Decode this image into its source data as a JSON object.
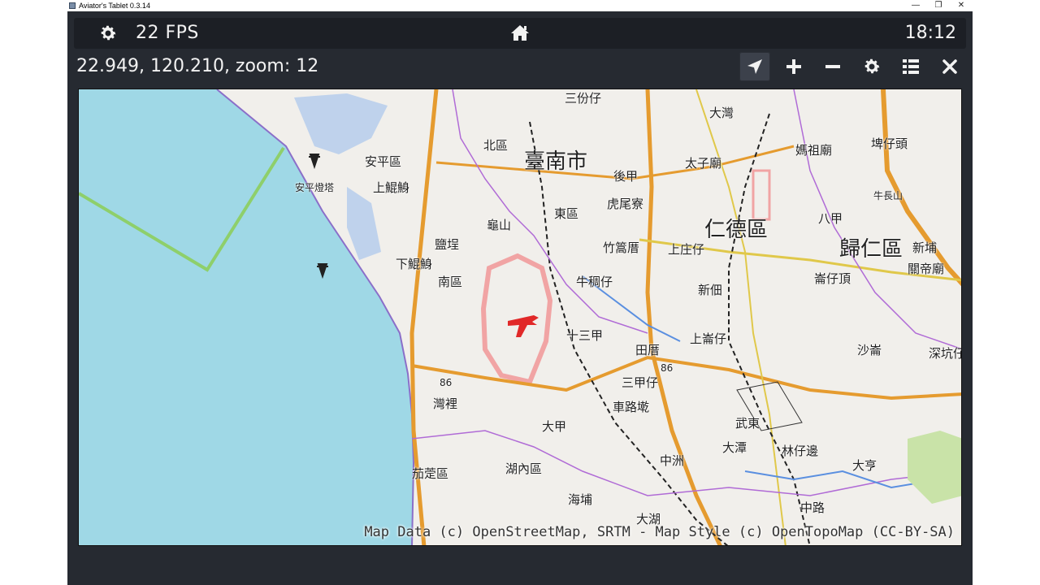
{
  "window": {
    "title": "Aviator's Tablet  0.3.14",
    "minimize": "—",
    "restore": "❐",
    "close": "✕"
  },
  "topbar": {
    "fps": "22 FPS",
    "clock": "18:12",
    "icons": [
      "gear-icon",
      "home-icon"
    ]
  },
  "infobar": {
    "coords": "22.949, 120.210, zoom: 12",
    "tools": [
      "locate-arrow-icon",
      "plus-icon",
      "minus-icon",
      "gear-icon",
      "list-icon",
      "close-icon"
    ]
  },
  "map": {
    "attribution": "Map Data (c) OpenStreetMap, SRTM - Map Style (c) OpenTopoMap (CC-BY-SA)",
    "places": {
      "tainan": "臺南市",
      "rende": "仁德區",
      "guiren": "歸仁區",
      "anping": "安平區",
      "anping_fort": "安平燈塔",
      "north": "北區",
      "east": "東區",
      "south": "南區",
      "yanpu": "鹽埕",
      "shangguan": "上鯤鯓",
      "xiaguan": "下鯤鯓",
      "guiyuan": "虎尾寮",
      "zhupu": "竹篙厝",
      "shangzhuang": "上庄仔",
      "niuchou": "牛稠仔",
      "shisanjia": "十三甲",
      "tianliao": "田厝",
      "shangbao": "上崙仔",
      "sanjia": "三甲仔",
      "chezhuang": "車路墘",
      "wudong": "武東",
      "dajia": "大甲",
      "dachuan": "大潭",
      "linzi": "林仔邊",
      "zhongzhou": "中洲",
      "wanli": "灣裡",
      "qieding": "茄萣區",
      "hunei": "湖內區",
      "haipu": "海埔",
      "dahu": "大湖",
      "zhonglu": "中路",
      "sanfenzi": "三份仔",
      "dawan": "大灣",
      "taizimiao": "太子廟",
      "houjia": "後甲",
      "mazumiao": "媽祖廟",
      "peizilu": "埤仔頭",
      "niuchangshan": "牛長山",
      "bajia": "八甲",
      "puzaiding": "崙仔頂",
      "xindian": "新佃",
      "shaxun": "沙崙",
      "shenkangzi": "深坑仔",
      "xinbu": "新埔",
      "guandimiao": "關帝廟",
      "daxun": "大亨",
      "guishan": "龜山",
      "road86a": "86",
      "road86b": "86"
    }
  }
}
